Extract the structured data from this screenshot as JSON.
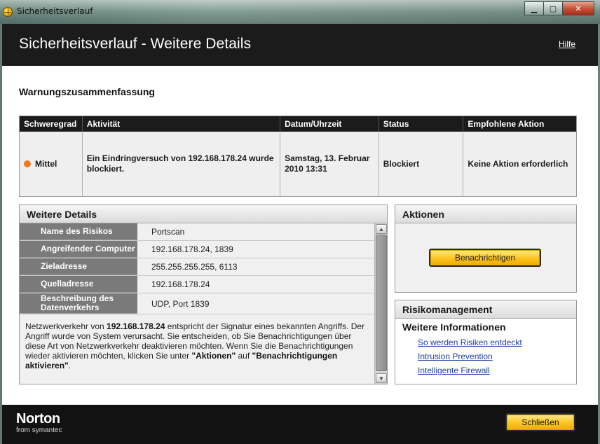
{
  "window": {
    "title": "Sicherheitsverlauf",
    "controls": {
      "minimize": "▁",
      "maximize": "▢",
      "close": "✕"
    }
  },
  "header": {
    "title": "Sicherheitsverlauf - Weitere Details",
    "help": "Hilfe"
  },
  "summary": {
    "title": "Warnungszusammenfassung",
    "columns": [
      "Schweregrad",
      "Aktivität",
      "Datum/Uhrzeit",
      "Status",
      "Empfohlene Aktion"
    ],
    "row": {
      "severity": "Mittel",
      "severity_color": "#f07a1d",
      "activity": "Ein Eindringversuch von 192.168.178.24 wurde blockiert.",
      "datetime": "Samstag, 13. Februar 2010 13:31",
      "status": "Blockiert",
      "action": "Keine Aktion erforderlich"
    }
  },
  "details": {
    "title": "Weitere Details",
    "rows": [
      {
        "label": "Name des Risikos",
        "value": "Portscan"
      },
      {
        "label": "Angreifender Computer",
        "value": "192.168.178.24, 1839"
      },
      {
        "label": "Zieladresse",
        "value": "255.255.255.255, 6113"
      },
      {
        "label": "Quelladresse",
        "value": "192.168.178.24"
      },
      {
        "label": "Beschreibung des Datenverkehrs",
        "value": "UDP, Port 1839"
      }
    ],
    "description": {
      "t1": "Netzwerkverkehr von ",
      "b1": "192.168.178.24",
      "t2": " entspricht der Signatur eines bekannten Angriffs. Der Angriff wurde von System verursacht. Sie entscheiden, ob Sie Benachrichtigungen über diese Art von Netzwerkverkehr deaktivieren möchten. Wenn Sie die Benachrichtigungen wieder aktivieren möchten, klicken Sie unter ",
      "b2": "\"Aktionen\"",
      "t3": " auf ",
      "b3": "\"Benachrichtigungen aktivieren\"",
      "t4": "."
    },
    "scroll": {
      "up": "▲",
      "down": "▼"
    }
  },
  "actions": {
    "title": "Aktionen",
    "notify_button": "Benachrichtigen"
  },
  "risk": {
    "title": "Risikomanagement",
    "subtitle": "Weitere Informationen",
    "links": [
      "So werden Risiken entdeckt",
      "Intrusion Prevention",
      "Intelligente Firewall"
    ]
  },
  "footer": {
    "logo": "Norton",
    "logo_sub": "from symantec",
    "close_button": "Schließen"
  },
  "colors": {
    "accent_button": "#fcc31e",
    "header_bg": "#1b1b1b",
    "link": "#1e3f9e"
  }
}
